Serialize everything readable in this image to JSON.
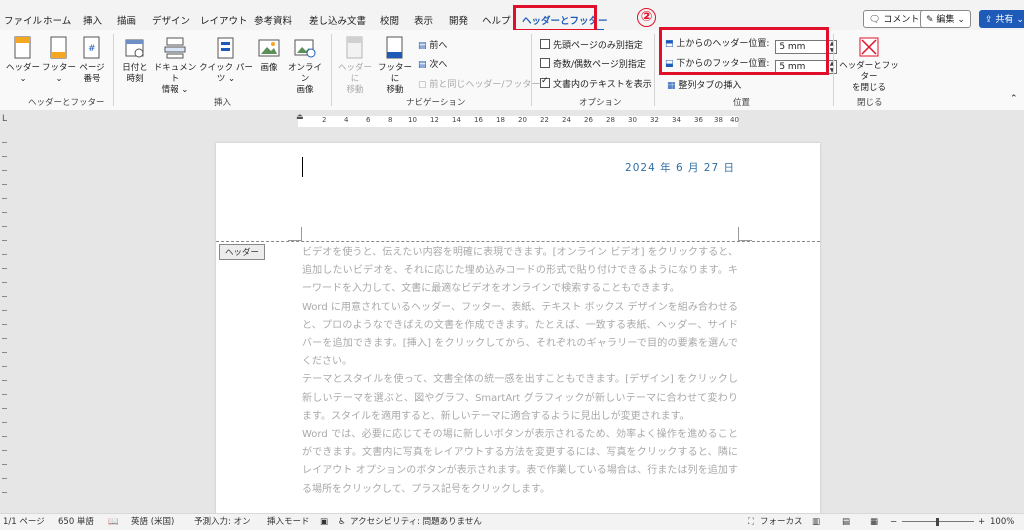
{
  "tabs": [
    {
      "label": "ファイル"
    },
    {
      "label": "ホーム"
    },
    {
      "label": "挿入"
    },
    {
      "label": "描画"
    },
    {
      "label": "デザイン"
    },
    {
      "label": "レイアウト"
    },
    {
      "label": "参考資料"
    },
    {
      "label": "差し込み文書"
    },
    {
      "label": "校閲"
    },
    {
      "label": "表示"
    },
    {
      "label": "開発"
    },
    {
      "label": "ヘルプ"
    },
    {
      "label": "ヘッダーとフッター"
    }
  ],
  "step_badge": "②",
  "top_buttons": {
    "comment": "コメント",
    "edit": "編集",
    "share": "共有"
  },
  "ribbon": {
    "groups": {
      "header_footer": "ヘッダーとフッター",
      "insert": "挿入",
      "navigation": "ナビゲーション",
      "options": "オプション",
      "position": "位置",
      "close": "閉じる"
    },
    "buttons": {
      "header": "ヘッダー",
      "footer": "フッター",
      "page_number_1": "ページ",
      "page_number_2": "番号",
      "date_time_1": "日付と",
      "date_time_2": "時刻",
      "doc_info_1": "ドキュメント",
      "doc_info_2": "情報",
      "quick_parts": "クイック パーツ",
      "picture": "画像",
      "online_picture_1": "オンライン",
      "online_picture_2": "画像",
      "goto_header_1": "ヘッダーに",
      "goto_header_2": "移動",
      "goto_footer_1": "フッターに",
      "goto_footer_2": "移動",
      "previous": "前へ",
      "next": "次へ",
      "link_previous": "前と同じヘッダー/フッター",
      "close_1": "ヘッダーとフッター",
      "close_2": "を閉じる"
    },
    "options": {
      "first_page": "先頭ページのみ別指定",
      "odd_even": "奇数/偶数ページ別指定",
      "show_text": "文書内のテキストを表示",
      "first_page_checked": false,
      "odd_even_checked": false,
      "show_text_checked": true
    },
    "position": {
      "header_from_top_label": "上からのヘッダー位置:",
      "header_from_top_value": "5 mm",
      "footer_from_bottom_label": "下からのフッター位置:",
      "footer_from_bottom_value": "5 mm",
      "insert_tab": "整列タブの挿入"
    }
  },
  "ruler": {
    "numbers": [
      "2",
      "4",
      "6",
      "8",
      "10",
      "12",
      "14",
      "16",
      "18",
      "20",
      "22",
      "24",
      "26",
      "28",
      "30",
      "32",
      "34",
      "36",
      "38",
      "40"
    ]
  },
  "document": {
    "header_date": "2024 年 6 月 27 日",
    "header_tag": "ヘッダー",
    "paragraphs": [
      "ビデオを使うと、伝えたい内容を明確に表現できます。[オンライン ビデオ] をクリックすると、追加したいビデオを、それに応じた埋め込みコードの形式で貼り付けできるようになります。キーワードを入力して、文書に最適なビデオをオンラインで検索することもできます。",
      "Word に用意されているヘッダー、フッター、表紙、テキスト ボックス デザインを組み合わせると、プロのようなできばえの文書を作成できます。たとえば、一致する表紙、ヘッダー、サイドバーを追加できます。[挿入] をクリックしてから、それぞれのギャラリーで目的の要素を選んでください。",
      "テーマとスタイルを使って、文書全体の統一感を出すこともできます。[デザイン] をクリックし新しいテーマを選ぶと、図やグラフ、SmartArt グラフィックが新しいテーマに合わせて変わります。スタイルを適用すると、新しいテーマに適合するように見出しが変更されます。",
      "Word では、必要に応じてその場に新しいボタンが表示されるため、効率よく操作を進めることができます。文書内に写真をレイアウトする方法を変更するには、写真をクリックすると、隣にレイアウト オプションのボタンが表示されます。表で作業している場合は、行または列を追加する場所をクリックして、プラス記号をクリックします。"
    ]
  },
  "status": {
    "page": "1/1 ページ",
    "words": "650 単語",
    "language": "英語 (米国)",
    "prediction": "予測入力: オン",
    "insert_mode": "挿入モード",
    "accessibility": "アクセシビリティ: 問題ありません",
    "focus": "フォーカス",
    "zoom": "100%"
  },
  "colors": {
    "accent": "#1e5bb8",
    "highlight": "#e0102a",
    "date": "#2f6ea5"
  }
}
